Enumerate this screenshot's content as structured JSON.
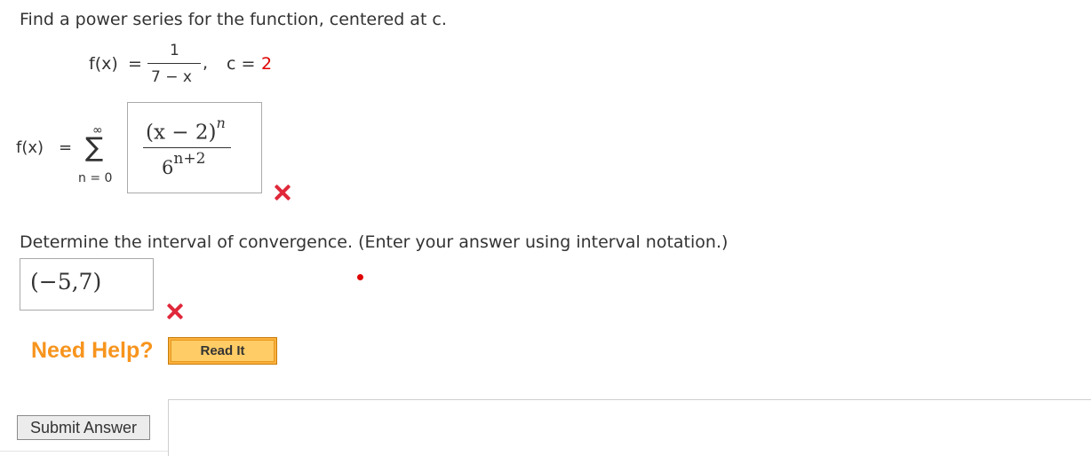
{
  "question": {
    "prompt": "Find a power series for the function, centered at c.",
    "function_label": "f(x)",
    "equals": "=",
    "numerator": "1",
    "denominator": "7 − x",
    "comma": ",",
    "c_label": "c =",
    "c_value": "2"
  },
  "series": {
    "label": "f(x)",
    "equals": "=",
    "sigma": "∑",
    "upper_limit": "∞",
    "lower_limit": "n = 0",
    "answer_numerator": "(x − 2)",
    "answer_numerator_exp": "n",
    "answer_denominator_base": "6",
    "answer_denominator_exp": "n+2",
    "status": "incorrect"
  },
  "interval": {
    "prompt": "Determine the interval of convergence. (Enter your answer using interval notation.)",
    "answer": "(−5,7)",
    "status": "incorrect"
  },
  "help": {
    "label": "Need Help?",
    "read_it_label": "Read It"
  },
  "submit_label": "Submit Answer",
  "colors": {
    "accent_red": "#e00000",
    "incorrect_mark": "#e0283a",
    "help_orange": "#f7941d",
    "read_it_bg": "#fbb03b"
  }
}
